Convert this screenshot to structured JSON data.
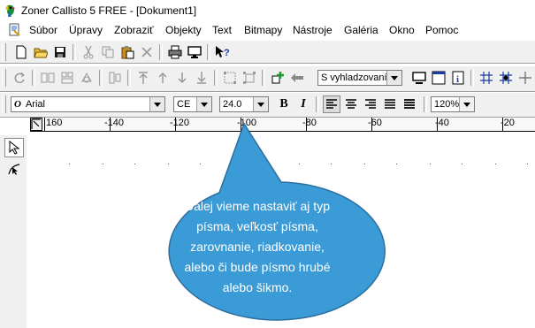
{
  "window": {
    "title": "Zoner Callisto 5 FREE - [Dokument1]"
  },
  "menu": {
    "items": [
      "Súbor",
      "Úpravy",
      "Zobraziť",
      "Objekty",
      "Text",
      "Bitmapy",
      "Nástroje",
      "Galéria",
      "Okno",
      "Pomoc"
    ]
  },
  "toolbar2": {
    "smoothing_select": "S vyhladzovaním"
  },
  "text_toolbar": {
    "font": "Arial",
    "encoding": "CE",
    "size": "24.0",
    "bold": "B",
    "italic": "I",
    "zoom": "120%"
  },
  "ruler": {
    "ticks": [
      "160",
      "-140",
      "-120",
      "-100",
      "-80",
      "-60",
      "-40",
      "-20"
    ]
  },
  "callout": {
    "lines": [
      "Ďalej vieme nastaviť aj typ",
      "písma, veľkosť písma,",
      "zarovnanie, riadkovanie,",
      "alebo či bude písmo hrubé",
      "alebo šikmo."
    ],
    "color": "#3b9bd6"
  }
}
